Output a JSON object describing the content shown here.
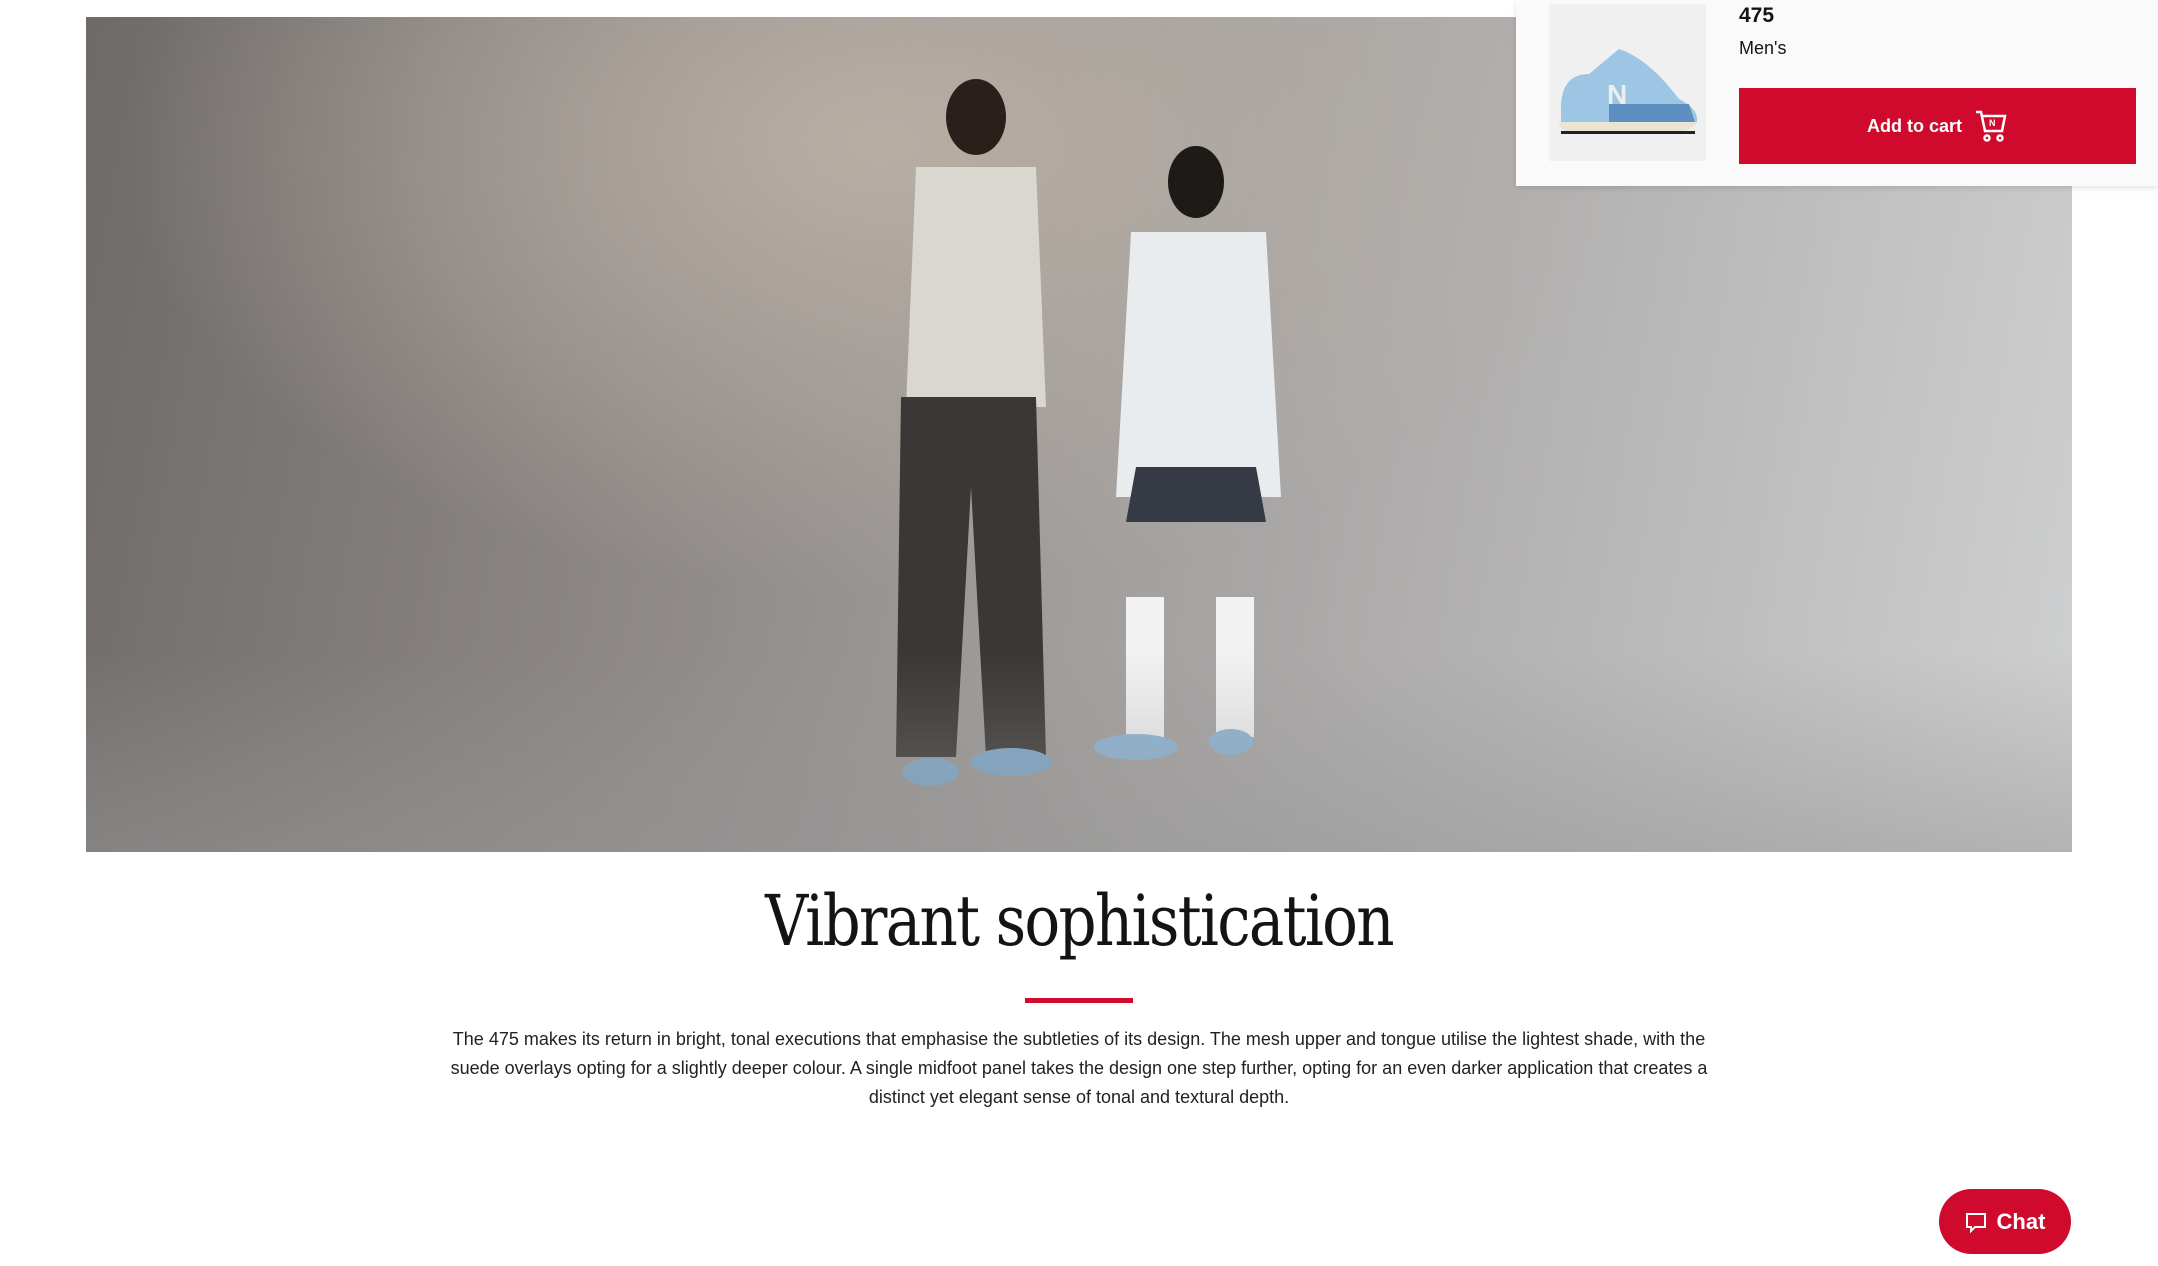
{
  "hero": {
    "image_alt_icon": "lifestyle-photo"
  },
  "popup": {
    "product_name": "475",
    "category": "Men's",
    "add_to_cart_label": "Add to cart",
    "cart_icon": "shopping-cart-icon"
  },
  "section": {
    "heading": "Vibrant sophistication",
    "body": "The 475 makes its return in bright, tonal executions that emphasise the subtleties of its design. The mesh upper and tongue utilise the lightest shade, with the suede overlays opting for a slightly deeper colour. A single midfoot panel takes the design one step further, opting for an even darker application that creates a distinct yet elegant sense of tonal and textural depth."
  },
  "chat": {
    "label": "Chat",
    "icon": "chat-bubble-icon"
  },
  "colors": {
    "accent": "#cf0a2c"
  }
}
